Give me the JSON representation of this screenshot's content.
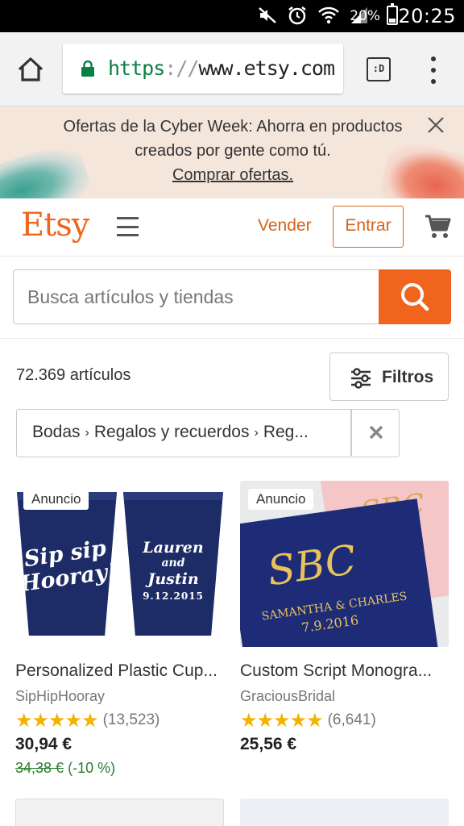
{
  "status_bar": {
    "battery_percent": "20%",
    "time": "20:25",
    "icons": [
      "mute-icon",
      "alarm-icon",
      "wifi-icon",
      "signal-icon",
      "battery-icon"
    ]
  },
  "browser": {
    "url_scheme": "https",
    "url_separator": "://",
    "url_host": "www.etsy.com",
    "tabs_label": ":D"
  },
  "banner": {
    "line1": "Ofertas de la Cyber Week: Ahorra en productos creados por gente como tú.",
    "cta": "Comprar ofertas."
  },
  "header": {
    "logo": "Etsy",
    "sell_label": "Vender",
    "signin_label": "Entrar",
    "accent_color": "#f1641e"
  },
  "search": {
    "placeholder": "Busca artículos y tiendas"
  },
  "results": {
    "count": "72.369 artículos",
    "filters_label": "Filtros",
    "breadcrumb": [
      "Bodas",
      "Regalos y recuerdos",
      "Reg..."
    ]
  },
  "products": [
    {
      "badge": "Anuncio",
      "title": "Personalized Plastic Cup...",
      "shop": "SipHipHooray",
      "stars": "★★★★★",
      "reviews": "(13,523)",
      "price": "30,94 €",
      "original_price": "34,38 €",
      "discount": "(-10 %)",
      "image_text_left": "Sip sip Hooray!",
      "image_text_right_1": "Lauren",
      "image_text_right_2": "and",
      "image_text_right_3": "Justin",
      "image_text_right_4": "9.12.2015"
    },
    {
      "badge": "Anuncio",
      "title": "Custom Script Monogra...",
      "shop": "GraciousBridal",
      "stars": "★★★★★",
      "reviews": "(6,641)",
      "price": "25,56 €",
      "image_monogram": "SBC",
      "image_names": "SAMANTHA & CHARLES",
      "image_date": "7.9.2016"
    }
  ]
}
